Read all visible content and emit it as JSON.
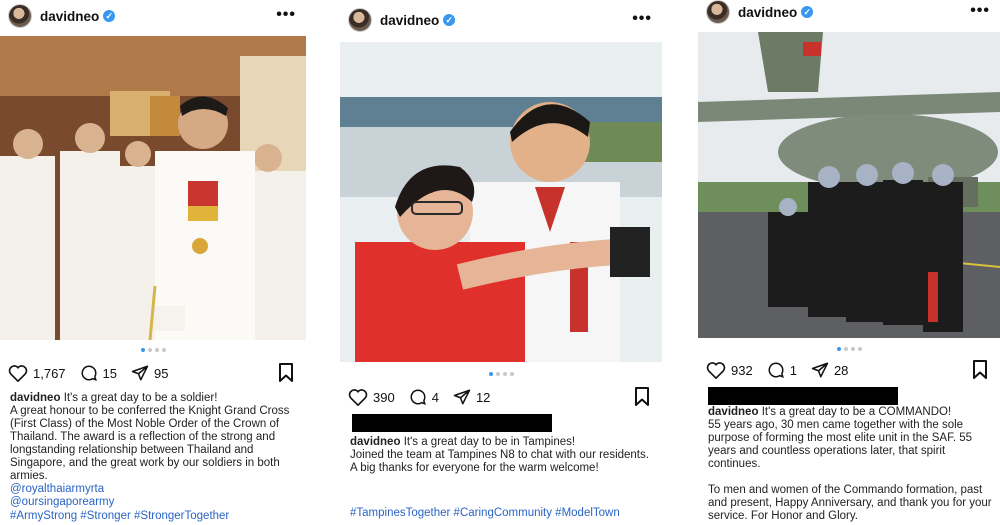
{
  "posts": [
    {
      "username": "davidneo",
      "likes": "1,767",
      "comments": "15",
      "shares": "95",
      "caption_head": "It's a great day to be a soldier!",
      "caption_body": "A great honour to be conferred the Knight Grand Cross (First Class) of the Most Noble Order of the Crown of Thailand. The award is a reflection of the strong and longstanding relationship between Thailand and Singapore, and the great work by our soldiers in both armies.",
      "mention_1": "@royalthaiarmyrta",
      "mention_2": "@oursingaporearmy",
      "hashtags": "#ArmyStrong #Stronger #StrongerTogether"
    },
    {
      "username": "davidneo",
      "likes": "390",
      "comments": "4",
      "shares": "12",
      "caption_head": "It's a great day to be in Tampines!",
      "caption_body": "Joined the team at Tampines N8 to chat with our residents. A big thanks for everyone for the warm welcome!",
      "hashtags": "#TampinesTogether #CaringCommunity #ModelTown"
    },
    {
      "username": "davidneo",
      "likes": "932",
      "comments": "1",
      "shares": "28",
      "caption_head": "It's a great day to be a COMMANDO!",
      "caption_body": "55 years ago, 30 men came together with the sole purpose of forming the most elite unit in the SAF. 55 years and countless operations later, that spirit continues.",
      "caption_body_2": "To men and women of the Commando formation, past and present, Happy Anniversary, and thank you for your service. For Honor and Glory."
    }
  ],
  "icons": {
    "verified": "verified-badge-icon",
    "more": "more-options-icon",
    "like": "heart-icon",
    "comment": "comment-icon",
    "share": "send-icon",
    "save": "bookmark-icon"
  },
  "colors": {
    "link": "#2a64c6",
    "verified": "#3897f0",
    "active_dot": "#3897f0"
  }
}
